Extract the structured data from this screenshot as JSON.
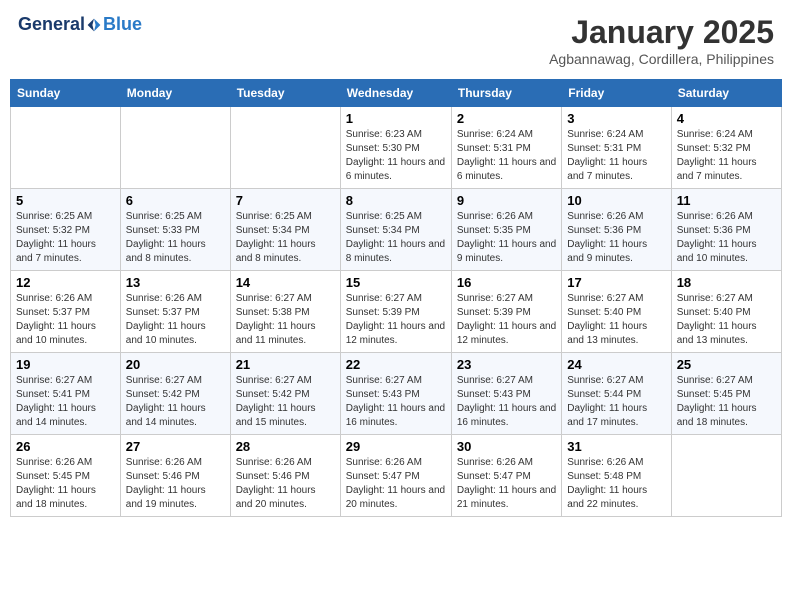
{
  "header": {
    "logo_general": "General",
    "logo_blue": "Blue",
    "month_title": "January 2025",
    "subtitle": "Agbannawag, Cordillera, Philippines"
  },
  "days_of_week": [
    "Sunday",
    "Monday",
    "Tuesday",
    "Wednesday",
    "Thursday",
    "Friday",
    "Saturday"
  ],
  "weeks": [
    [
      {
        "day": "",
        "info": ""
      },
      {
        "day": "",
        "info": ""
      },
      {
        "day": "",
        "info": ""
      },
      {
        "day": "1",
        "info": "Sunrise: 6:23 AM\nSunset: 5:30 PM\nDaylight: 11 hours\nand 6 minutes."
      },
      {
        "day": "2",
        "info": "Sunrise: 6:24 AM\nSunset: 5:31 PM\nDaylight: 11 hours\nand 6 minutes."
      },
      {
        "day": "3",
        "info": "Sunrise: 6:24 AM\nSunset: 5:31 PM\nDaylight: 11 hours\nand 7 minutes."
      },
      {
        "day": "4",
        "info": "Sunrise: 6:24 AM\nSunset: 5:32 PM\nDaylight: 11 hours\nand 7 minutes."
      }
    ],
    [
      {
        "day": "5",
        "info": "Sunrise: 6:25 AM\nSunset: 5:32 PM\nDaylight: 11 hours\nand 7 minutes."
      },
      {
        "day": "6",
        "info": "Sunrise: 6:25 AM\nSunset: 5:33 PM\nDaylight: 11 hours\nand 8 minutes."
      },
      {
        "day": "7",
        "info": "Sunrise: 6:25 AM\nSunset: 5:34 PM\nDaylight: 11 hours\nand 8 minutes."
      },
      {
        "day": "8",
        "info": "Sunrise: 6:25 AM\nSunset: 5:34 PM\nDaylight: 11 hours\nand 8 minutes."
      },
      {
        "day": "9",
        "info": "Sunrise: 6:26 AM\nSunset: 5:35 PM\nDaylight: 11 hours\nand 9 minutes."
      },
      {
        "day": "10",
        "info": "Sunrise: 6:26 AM\nSunset: 5:36 PM\nDaylight: 11 hours\nand 9 minutes."
      },
      {
        "day": "11",
        "info": "Sunrise: 6:26 AM\nSunset: 5:36 PM\nDaylight: 11 hours\nand 10 minutes."
      }
    ],
    [
      {
        "day": "12",
        "info": "Sunrise: 6:26 AM\nSunset: 5:37 PM\nDaylight: 11 hours\nand 10 minutes."
      },
      {
        "day": "13",
        "info": "Sunrise: 6:26 AM\nSunset: 5:37 PM\nDaylight: 11 hours\nand 10 minutes."
      },
      {
        "day": "14",
        "info": "Sunrise: 6:27 AM\nSunset: 5:38 PM\nDaylight: 11 hours\nand 11 minutes."
      },
      {
        "day": "15",
        "info": "Sunrise: 6:27 AM\nSunset: 5:39 PM\nDaylight: 11 hours\nand 12 minutes."
      },
      {
        "day": "16",
        "info": "Sunrise: 6:27 AM\nSunset: 5:39 PM\nDaylight: 11 hours\nand 12 minutes."
      },
      {
        "day": "17",
        "info": "Sunrise: 6:27 AM\nSunset: 5:40 PM\nDaylight: 11 hours\nand 13 minutes."
      },
      {
        "day": "18",
        "info": "Sunrise: 6:27 AM\nSunset: 5:40 PM\nDaylight: 11 hours\nand 13 minutes."
      }
    ],
    [
      {
        "day": "19",
        "info": "Sunrise: 6:27 AM\nSunset: 5:41 PM\nDaylight: 11 hours\nand 14 minutes."
      },
      {
        "day": "20",
        "info": "Sunrise: 6:27 AM\nSunset: 5:42 PM\nDaylight: 11 hours\nand 14 minutes."
      },
      {
        "day": "21",
        "info": "Sunrise: 6:27 AM\nSunset: 5:42 PM\nDaylight: 11 hours\nand 15 minutes."
      },
      {
        "day": "22",
        "info": "Sunrise: 6:27 AM\nSunset: 5:43 PM\nDaylight: 11 hours\nand 16 minutes."
      },
      {
        "day": "23",
        "info": "Sunrise: 6:27 AM\nSunset: 5:43 PM\nDaylight: 11 hours\nand 16 minutes."
      },
      {
        "day": "24",
        "info": "Sunrise: 6:27 AM\nSunset: 5:44 PM\nDaylight: 11 hours\nand 17 minutes."
      },
      {
        "day": "25",
        "info": "Sunrise: 6:27 AM\nSunset: 5:45 PM\nDaylight: 11 hours\nand 18 minutes."
      }
    ],
    [
      {
        "day": "26",
        "info": "Sunrise: 6:26 AM\nSunset: 5:45 PM\nDaylight: 11 hours\nand 18 minutes."
      },
      {
        "day": "27",
        "info": "Sunrise: 6:26 AM\nSunset: 5:46 PM\nDaylight: 11 hours\nand 19 minutes."
      },
      {
        "day": "28",
        "info": "Sunrise: 6:26 AM\nSunset: 5:46 PM\nDaylight: 11 hours\nand 20 minutes."
      },
      {
        "day": "29",
        "info": "Sunrise: 6:26 AM\nSunset: 5:47 PM\nDaylight: 11 hours\nand 20 minutes."
      },
      {
        "day": "30",
        "info": "Sunrise: 6:26 AM\nSunset: 5:47 PM\nDaylight: 11 hours\nand 21 minutes."
      },
      {
        "day": "31",
        "info": "Sunrise: 6:26 AM\nSunset: 5:48 PM\nDaylight: 11 hours\nand 22 minutes."
      },
      {
        "day": "",
        "info": ""
      }
    ]
  ]
}
